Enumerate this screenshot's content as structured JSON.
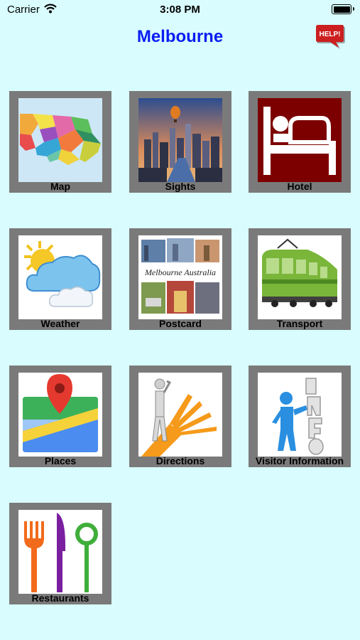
{
  "status_bar": {
    "carrier": "Carrier",
    "time": "3:08 PM"
  },
  "header": {
    "title": "Melbourne",
    "help_label": "HELP!"
  },
  "tiles": [
    {
      "label": "Map",
      "icon": "victoria-map-icon"
    },
    {
      "label": "Sights",
      "icon": "city-balloon-photo-icon"
    },
    {
      "label": "Hotel",
      "icon": "hotel-bed-icon"
    },
    {
      "label": "Weather",
      "icon": "sun-cloud-icon"
    },
    {
      "label": "Postcard",
      "icon": "postcard-collage-icon"
    },
    {
      "label": "Transport",
      "icon": "tram-icon"
    },
    {
      "label": "Places",
      "icon": "map-pin-icon"
    },
    {
      "label": "Directions",
      "icon": "directions-arrows-icon"
    },
    {
      "label": "Visitor Information",
      "icon": "info-figure-icon"
    },
    {
      "label": "Restaurants",
      "icon": "cutlery-icon"
    }
  ],
  "postcard_text": "Melbourne Australia",
  "colors": {
    "background": "#d9fdfe",
    "title": "#0a1df2",
    "tile_frame": "#7a7a7a",
    "help": "#cc1f1f"
  }
}
